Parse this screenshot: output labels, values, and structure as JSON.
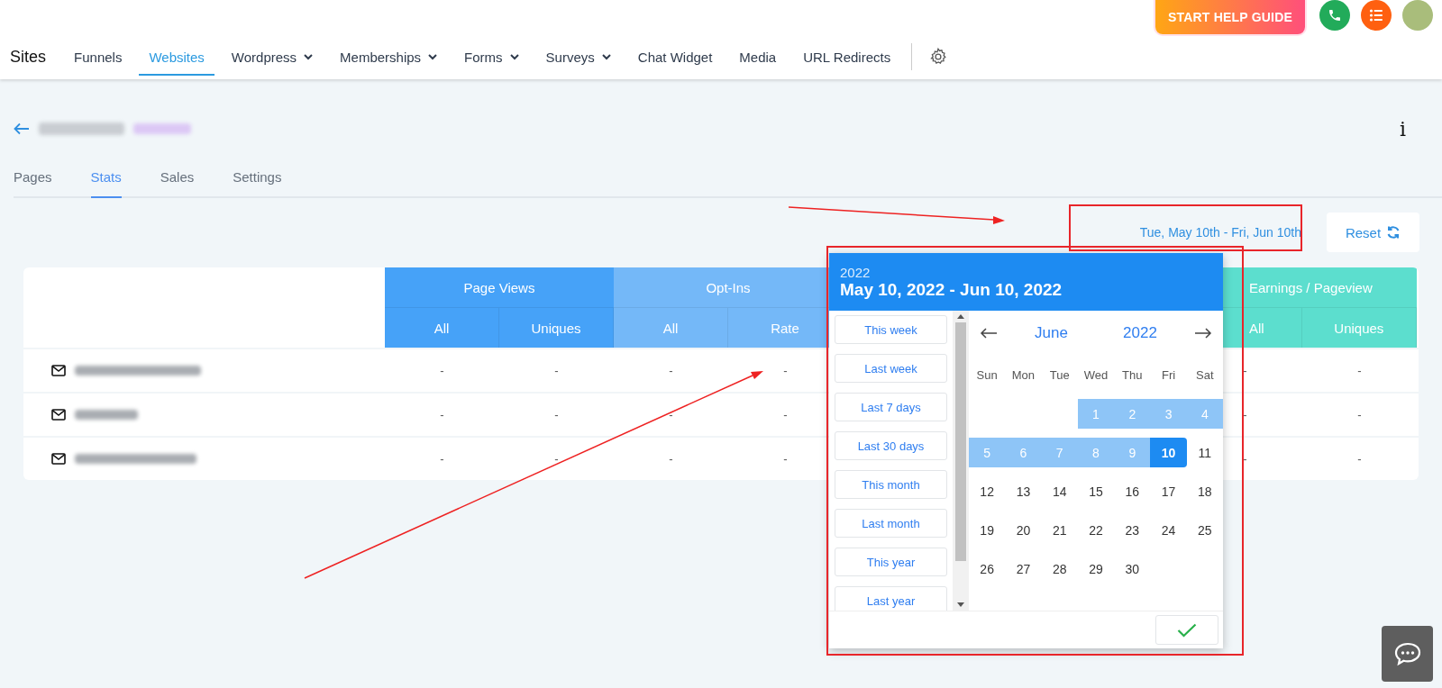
{
  "topbar": {
    "help_button": "START HELP GUIDE"
  },
  "nav": {
    "title": "Sites",
    "items": [
      {
        "label": "Funnels",
        "selected": false,
        "dropdown": false
      },
      {
        "label": "Websites",
        "selected": true,
        "dropdown": false
      },
      {
        "label": "Wordpress",
        "selected": false,
        "dropdown": true
      },
      {
        "label": "Memberships",
        "selected": false,
        "dropdown": true
      },
      {
        "label": "Forms",
        "selected": false,
        "dropdown": true
      },
      {
        "label": "Surveys",
        "selected": false,
        "dropdown": true
      },
      {
        "label": "Chat Widget",
        "selected": false,
        "dropdown": false
      },
      {
        "label": "Media",
        "selected": false,
        "dropdown": false
      },
      {
        "label": "URL Redirects",
        "selected": false,
        "dropdown": false
      }
    ]
  },
  "page": {
    "info_glyph": "i",
    "tabs": [
      {
        "label": "Pages",
        "selected": false
      },
      {
        "label": "Stats",
        "selected": true
      },
      {
        "label": "Sales",
        "selected": false
      },
      {
        "label": "Settings",
        "selected": false
      }
    ],
    "date_range": "Tue, May 10th - Fri, Jun 10th",
    "reset_button": "Reset"
  },
  "table": {
    "groups": [
      {
        "title": "Page Views",
        "color": "#46a2f8",
        "columns": [
          "All",
          "Uniques"
        ]
      },
      {
        "title": "Opt-Ins",
        "color": "#74b8f8",
        "columns": [
          "All",
          "Rate"
        ]
      },
      {
        "title": "Earnings / Pageview",
        "color": "#5cdece",
        "columns": [
          "All",
          "Uniques"
        ]
      }
    ],
    "rows": [
      {
        "values": [
          "-",
          "-",
          "-",
          "-",
          "-",
          "-"
        ]
      },
      {
        "values": [
          "-",
          "-",
          "-",
          "-",
          "-",
          "-"
        ]
      },
      {
        "values": [
          "-",
          "-",
          "-",
          "-",
          "-",
          "-"
        ]
      }
    ]
  },
  "date_picker": {
    "year": "2022",
    "range": "May 10, 2022 - Jun 10, 2022",
    "presets": [
      "This week",
      "Last week",
      "Last 7 days",
      "Last 30 days",
      "This month",
      "Last month",
      "This year",
      "Last year"
    ],
    "month": "June",
    "month_year": "2022",
    "weekdays": [
      "Sun",
      "Mon",
      "Tue",
      "Wed",
      "Thu",
      "Fri",
      "Sat"
    ],
    "days": [
      {
        "kind": "blank"
      },
      {
        "kind": "blank"
      },
      {
        "kind": "blank"
      },
      {
        "kind": "day",
        "label": "1",
        "in_range": true,
        "selected": false
      },
      {
        "kind": "day",
        "label": "2",
        "in_range": true,
        "selected": false
      },
      {
        "kind": "day",
        "label": "3",
        "in_range": true,
        "selected": false
      },
      {
        "kind": "day",
        "label": "4",
        "in_range": true,
        "selected": false
      },
      {
        "kind": "day",
        "label": "5",
        "in_range": true,
        "selected": false
      },
      {
        "kind": "day",
        "label": "6",
        "in_range": true,
        "selected": false
      },
      {
        "kind": "day",
        "label": "7",
        "in_range": true,
        "selected": false
      },
      {
        "kind": "day",
        "label": "8",
        "in_range": true,
        "selected": false
      },
      {
        "kind": "day",
        "label": "9",
        "in_range": true,
        "selected": false
      },
      {
        "kind": "day",
        "label": "10",
        "in_range": true,
        "selected": true
      },
      {
        "kind": "day",
        "label": "11",
        "in_range": false,
        "selected": false
      },
      {
        "kind": "day",
        "label": "12",
        "in_range": false,
        "selected": false
      },
      {
        "kind": "day",
        "label": "13",
        "in_range": false,
        "selected": false
      },
      {
        "kind": "day",
        "label": "14",
        "in_range": false,
        "selected": false
      },
      {
        "kind": "day",
        "label": "15",
        "in_range": false,
        "selected": false
      },
      {
        "kind": "day",
        "label": "16",
        "in_range": false,
        "selected": false
      },
      {
        "kind": "day",
        "label": "17",
        "in_range": false,
        "selected": false
      },
      {
        "kind": "day",
        "label": "18",
        "in_range": false,
        "selected": false
      },
      {
        "kind": "day",
        "label": "19",
        "in_range": false,
        "selected": false
      },
      {
        "kind": "day",
        "label": "20",
        "in_range": false,
        "selected": false
      },
      {
        "kind": "day",
        "label": "21",
        "in_range": false,
        "selected": false
      },
      {
        "kind": "day",
        "label": "22",
        "in_range": false,
        "selected": false
      },
      {
        "kind": "day",
        "label": "23",
        "in_range": false,
        "selected": false
      },
      {
        "kind": "day",
        "label": "24",
        "in_range": false,
        "selected": false
      },
      {
        "kind": "day",
        "label": "25",
        "in_range": false,
        "selected": false
      },
      {
        "kind": "day",
        "label": "26",
        "in_range": false,
        "selected": false
      },
      {
        "kind": "day",
        "label": "27",
        "in_range": false,
        "selected": false
      },
      {
        "kind": "day",
        "label": "28",
        "in_range": false,
        "selected": false
      },
      {
        "kind": "day",
        "label": "29",
        "in_range": false,
        "selected": false
      },
      {
        "kind": "day",
        "label": "30",
        "in_range": false,
        "selected": false
      }
    ]
  }
}
